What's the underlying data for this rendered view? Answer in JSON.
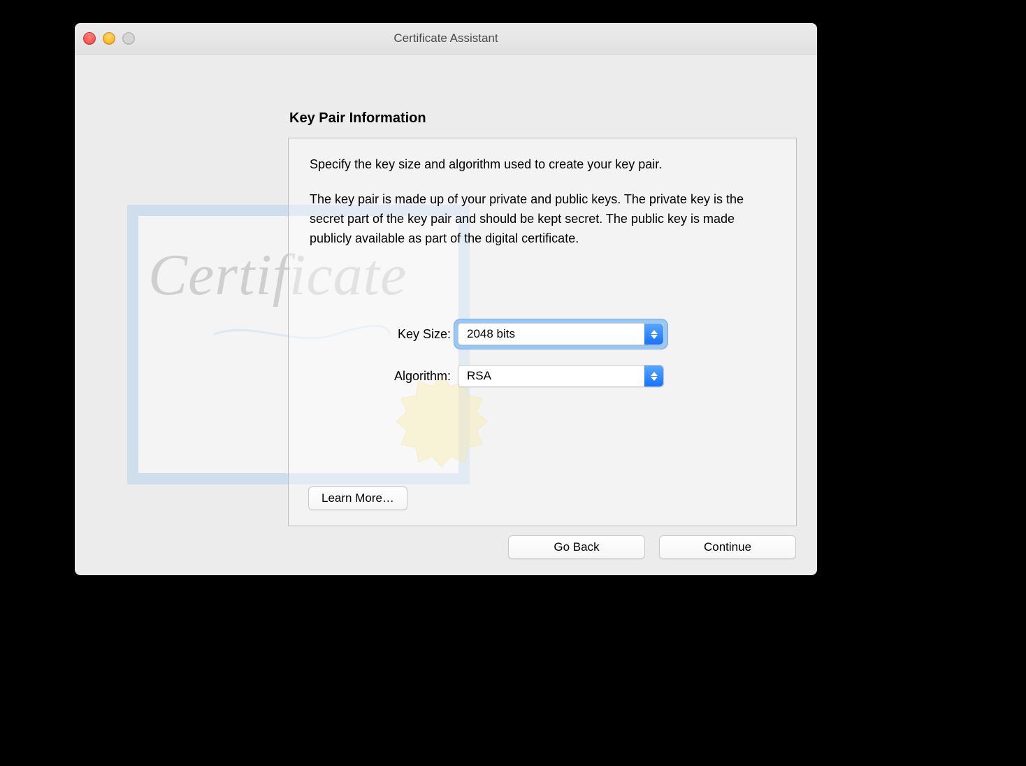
{
  "window": {
    "title": "Certificate Assistant"
  },
  "section": {
    "title": "Key Pair Information",
    "intro": "Specify the key size and algorithm used to create your key pair.",
    "description": "The key pair is made up of your private and public keys. The private key is the secret part of the key pair and should be kept secret. The public key is made publicly available as part of the digital certificate."
  },
  "form": {
    "key_size": {
      "label": "Key Size:",
      "value": "2048 bits"
    },
    "algorithm": {
      "label": "Algorithm:",
      "value": "RSA"
    }
  },
  "buttons": {
    "learn_more": "Learn More…",
    "go_back": "Go Back",
    "continue": "Continue"
  },
  "illustration": {
    "script_text": "Certificate"
  }
}
